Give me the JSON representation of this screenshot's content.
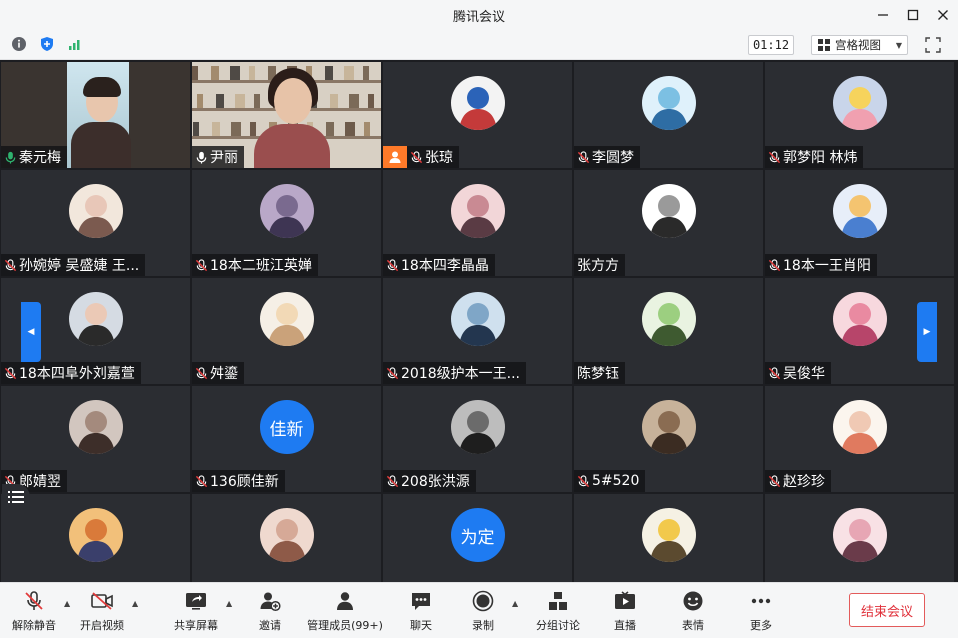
{
  "window": {
    "title": "腾讯会议",
    "controls": [
      "minimize-icon",
      "maximize-icon",
      "close-icon"
    ]
  },
  "toolbar": {
    "left_icons": [
      "info-icon",
      "shield-icon",
      "signal-icon"
    ],
    "timer": "01:12",
    "view_mode": "宫格视图",
    "fullscreen_icon": "fullscreen-icon"
  },
  "colors": {
    "accent": "#1e7bf2",
    "host_badge": "#ff7a29",
    "mute_red": "#e23b3b",
    "speaking_green": "#2fb36f",
    "end_red": "#e0303a"
  },
  "participants": [
    {
      "name": "秦元梅",
      "kind": "video1",
      "mic": "on"
    },
    {
      "name": "尹丽",
      "kind": "video2",
      "mic": "on-white"
    },
    {
      "name": "张琼",
      "kind": "avatar",
      "mic": "muted",
      "host": true,
      "av": [
        "#f3f3f3",
        "#2b63b8",
        "#c43a3a"
      ]
    },
    {
      "name": "李圆梦",
      "kind": "avatar",
      "mic": "muted",
      "av": [
        "#dff1fb",
        "#7cc0e3",
        "#2e6da4"
      ]
    },
    {
      "name": "郭梦阳   林炜",
      "kind": "avatar",
      "mic": "muted",
      "av": [
        "#c9d5ea",
        "#f6d35c",
        "#f0a0b0"
      ]
    },
    {
      "name": "孙婉婷 吴盛婕 王...",
      "kind": "avatar",
      "mic": "muted",
      "av": [
        "#f2e7dc",
        "#e8c7b8",
        "#7b5a4f"
      ]
    },
    {
      "name": "18本二班江英婵",
      "kind": "avatar",
      "mic": "muted",
      "av": [
        "#b9a8c8",
        "#7a6a8f",
        "#3e3553"
      ]
    },
    {
      "name": "18本四李晶晶",
      "kind": "avatar",
      "mic": "muted",
      "av": [
        "#f2d6d8",
        "#c98a93",
        "#5a3b44"
      ]
    },
    {
      "name": "张方方",
      "kind": "avatar",
      "mic": "none",
      "av": [
        "#ffffff",
        "#9a9a9a",
        "#2a2a2a"
      ]
    },
    {
      "name": "18本一王肖阳",
      "kind": "avatar",
      "mic": "muted",
      "av": [
        "#e7eef9",
        "#f4c470",
        "#4a7fd0"
      ]
    },
    {
      "name": "18本四阜外刘嘉萱",
      "kind": "avatar",
      "mic": "muted",
      "av": [
        "#d5dbe3",
        "#ebc9b6",
        "#2a2a2a"
      ]
    },
    {
      "name": "舛鎏",
      "kind": "avatar",
      "mic": "muted",
      "av": [
        "#f5efe6",
        "#f2d9b6",
        "#caa27a"
      ]
    },
    {
      "name": "2018级护本一王...",
      "kind": "avatar",
      "mic": "muted",
      "av": [
        "#cfe0ee",
        "#7fa6c7",
        "#23364f"
      ]
    },
    {
      "name": "陈梦钰",
      "kind": "avatar",
      "mic": "none",
      "av": [
        "#e9f3e1",
        "#9ccf80",
        "#3e5a30"
      ]
    },
    {
      "name": "吴俊华",
      "kind": "avatar",
      "mic": "muted",
      "av": [
        "#f7d8de",
        "#e98aa1",
        "#b7456a"
      ]
    },
    {
      "name": "郎婧翌",
      "kind": "avatar",
      "mic": "muted",
      "av": [
        "#d2c6bf",
        "#a48a7d",
        "#3d2e29"
      ]
    },
    {
      "name": "136顾佳新",
      "kind": "text",
      "text": "佳新",
      "mic": "muted"
    },
    {
      "name": "208张洪源",
      "kind": "avatar",
      "mic": "muted",
      "av": [
        "#bdbdbd",
        "#6b6b6b",
        "#1e1e1e"
      ]
    },
    {
      "name": "5#520",
      "kind": "avatar",
      "mic": "muted",
      "av": [
        "#c7b29a",
        "#8a6c52",
        "#3b2c22"
      ]
    },
    {
      "name": "赵珍珍",
      "kind": "avatar",
      "mic": "muted",
      "av": [
        "#fbf5ee",
        "#f0c9b4",
        "#e07a5f"
      ]
    },
    {
      "name": "",
      "kind": "avatar",
      "mic": "none",
      "av": [
        "#f2c07a",
        "#d97a3a",
        "#3a3f6b"
      ]
    },
    {
      "name": "",
      "kind": "avatar",
      "mic": "none",
      "av": [
        "#efd9cf",
        "#d6a997",
        "#8e5a48"
      ]
    },
    {
      "name": "",
      "kind": "text",
      "text": "为定",
      "mic": "none"
    },
    {
      "name": "",
      "kind": "avatar",
      "mic": "none",
      "av": [
        "#f5f1e4",
        "#f2c94c",
        "#5b4a2f"
      ]
    },
    {
      "name": "",
      "kind": "avatar",
      "mic": "none",
      "av": [
        "#f8e1e5",
        "#e7a6b4",
        "#6a3b4a"
      ]
    }
  ],
  "bottombar": {
    "buttons": [
      {
        "label": "解除静音",
        "icon": "mic-muted-icon"
      },
      {
        "label": "开启视频",
        "icon": "video-off-icon"
      },
      {
        "label": "共享屏幕",
        "icon": "share-screen-icon"
      },
      {
        "label": "邀请",
        "icon": "invite-icon"
      },
      {
        "label": "管理成员(99+)",
        "icon": "members-icon"
      },
      {
        "label": "聊天",
        "icon": "chat-icon"
      },
      {
        "label": "录制",
        "icon": "record-icon"
      },
      {
        "label": "分组讨论",
        "icon": "breakout-icon"
      },
      {
        "label": "直播",
        "icon": "live-icon"
      },
      {
        "label": "表情",
        "icon": "emoji-icon"
      },
      {
        "label": "更多",
        "icon": "more-icon"
      }
    ],
    "end_label": "结束会议"
  }
}
